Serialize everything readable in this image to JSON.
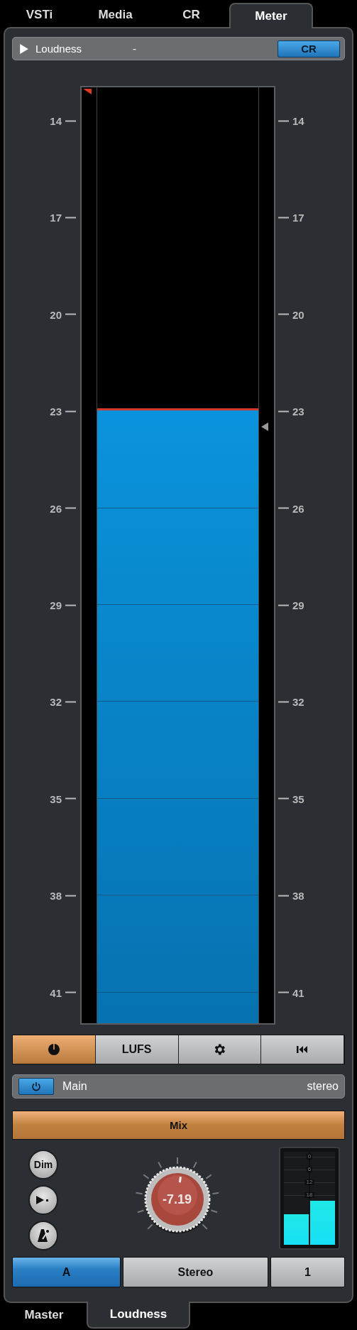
{
  "top_tabs": [
    {
      "label": "VSTi",
      "selected": false
    },
    {
      "label": "Media",
      "selected": false
    },
    {
      "label": "CR",
      "selected": false
    },
    {
      "label": "Meter",
      "selected": true
    }
  ],
  "header": {
    "title": "Loudness",
    "value": "-",
    "button": {
      "label": "CR",
      "on": true
    }
  },
  "meter": {
    "left_scale": [
      "14",
      "17",
      "20",
      "23",
      "26",
      "29",
      "32",
      "35",
      "38",
      "41"
    ],
    "right_scale": [
      "14",
      "17",
      "20",
      "23",
      "26",
      "29",
      "32",
      "35",
      "38",
      "41"
    ],
    "level": 0.655
  },
  "meter_toolbar": [
    {
      "kind": "power",
      "on": true
    },
    {
      "kind": "text",
      "label": "LUFS",
      "on": false
    },
    {
      "kind": "gear",
      "on": false
    },
    {
      "kind": "rewind",
      "on": false
    }
  ],
  "channel": {
    "enabled": true,
    "name": "Main",
    "format": "stereo"
  },
  "mix_button": {
    "label": "Mix",
    "on": true
  },
  "side_buttons": [
    {
      "kind": "text",
      "label": "Dim"
    },
    {
      "kind": "play"
    },
    {
      "kind": "metronome"
    }
  ],
  "knob": {
    "value": "-7.19"
  },
  "small_meter": {
    "scale": [
      "0",
      "6",
      "12",
      "18"
    ],
    "channels": [
      {
        "level": 0.33
      },
      {
        "level": 0.47
      }
    ]
  },
  "output_row": [
    {
      "label": "A",
      "selected": true
    },
    {
      "label": "Stereo",
      "selected": false
    },
    {
      "label": "1",
      "selected": false
    }
  ],
  "bottom_tabs": [
    {
      "label": "Master",
      "selected": false
    },
    {
      "label": "Loudness",
      "selected": true
    }
  ]
}
